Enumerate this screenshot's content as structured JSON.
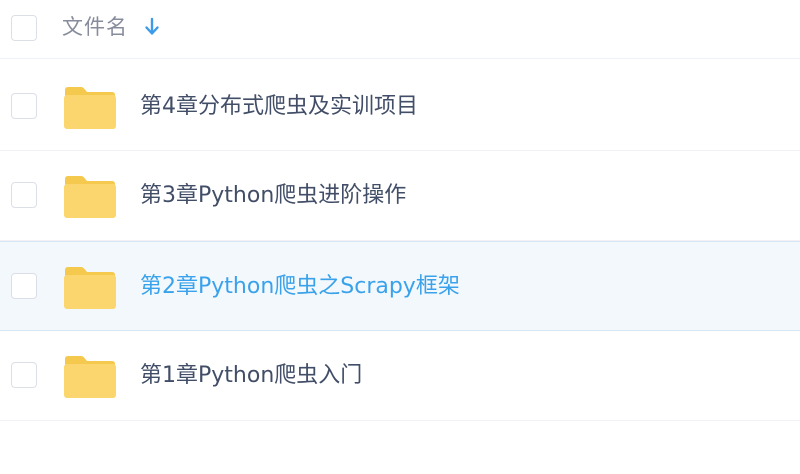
{
  "header": {
    "column_label": "文件名",
    "sort_icon": "arrow-down-icon",
    "sort_color": "#3d9be9"
  },
  "colors": {
    "folder": "#fbd66e",
    "folder_tab": "#f5c94d",
    "text": "#424e67",
    "selected_text": "#3aa2eb",
    "selected_bg": "#f3f8fd"
  },
  "files": [
    {
      "name": "第4章分布式爬虫及实训项目",
      "icon": "folder-icon",
      "selected": false
    },
    {
      "name": "第3章Python爬虫进阶操作",
      "icon": "folder-icon",
      "selected": false
    },
    {
      "name": "第2章Python爬虫之Scrapy框架",
      "icon": "folder-icon",
      "selected": true
    },
    {
      "name": "第1章Python爬虫入门",
      "icon": "folder-icon",
      "selected": false
    }
  ]
}
